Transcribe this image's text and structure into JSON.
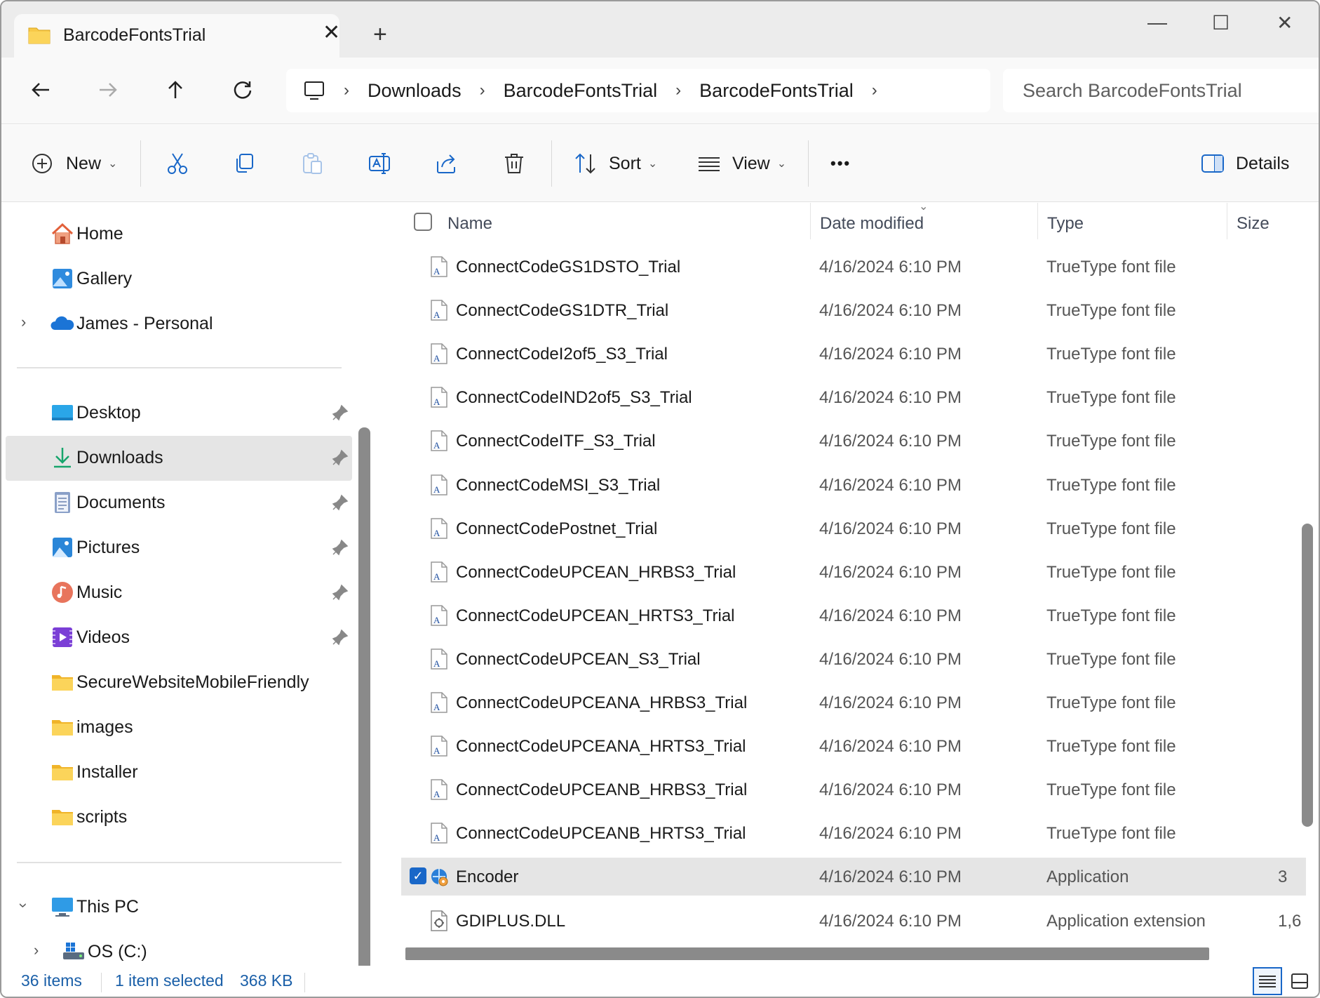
{
  "window": {
    "tab_title": "BarcodeFontsTrial",
    "tab_close": "✕",
    "new_tab": "+",
    "minimize": "—",
    "maximize": "☐",
    "close": "✕"
  },
  "breadcrumb": {
    "items": [
      "Downloads",
      "BarcodeFontsTrial",
      "BarcodeFontsTrial"
    ],
    "chevron": "›"
  },
  "search": {
    "placeholder": "Search BarcodeFontsTrial"
  },
  "toolbar": {
    "new_label": "New",
    "sort_label": "Sort",
    "view_label": "View",
    "more_label": "•••",
    "details_label": "Details",
    "caret": "⌄"
  },
  "sidebar": {
    "top": [
      {
        "label": "Home",
        "icon": "home-icon"
      },
      {
        "label": "Gallery",
        "icon": "gallery-icon"
      },
      {
        "label": "James - Personal",
        "icon": "onedrive-icon"
      }
    ],
    "quick": [
      {
        "label": "Desktop",
        "icon": "desktop-icon",
        "pinned": true
      },
      {
        "label": "Downloads",
        "icon": "downloads-icon",
        "pinned": true,
        "selected": true
      },
      {
        "label": "Documents",
        "icon": "documents-icon",
        "pinned": true
      },
      {
        "label": "Pictures",
        "icon": "pictures-icon",
        "pinned": true
      },
      {
        "label": "Music",
        "icon": "music-icon",
        "pinned": true
      },
      {
        "label": "Videos",
        "icon": "videos-icon",
        "pinned": true
      },
      {
        "label": "SecureWebsiteMobileFriendly",
        "icon": "folder-icon"
      },
      {
        "label": "images",
        "icon": "folder-icon"
      },
      {
        "label": "Installer",
        "icon": "folder-icon"
      },
      {
        "label": "scripts",
        "icon": "folder-icon"
      }
    ],
    "this_pc": "This PC",
    "os_drive": "OS (C:)"
  },
  "columns": {
    "name": "Name",
    "date": "Date modified",
    "type": "Type",
    "size": "Size"
  },
  "files": [
    {
      "name": "ConnectCodeGS1DSTO_Trial",
      "date": "4/16/2024 6:10 PM",
      "type": "TrueType font file",
      "size": ""
    },
    {
      "name": "ConnectCodeGS1DTR_Trial",
      "date": "4/16/2024 6:10 PM",
      "type": "TrueType font file",
      "size": ""
    },
    {
      "name": "ConnectCodeI2of5_S3_Trial",
      "date": "4/16/2024 6:10 PM",
      "type": "TrueType font file",
      "size": ""
    },
    {
      "name": "ConnectCodeIND2of5_S3_Trial",
      "date": "4/16/2024 6:10 PM",
      "type": "TrueType font file",
      "size": ""
    },
    {
      "name": "ConnectCodeITF_S3_Trial",
      "date": "4/16/2024 6:10 PM",
      "type": "TrueType font file",
      "size": ""
    },
    {
      "name": "ConnectCodeMSI_S3_Trial",
      "date": "4/16/2024 6:10 PM",
      "type": "TrueType font file",
      "size": ""
    },
    {
      "name": "ConnectCodePostnet_Trial",
      "date": "4/16/2024 6:10 PM",
      "type": "TrueType font file",
      "size": ""
    },
    {
      "name": "ConnectCodeUPCEAN_HRBS3_Trial",
      "date": "4/16/2024 6:10 PM",
      "type": "TrueType font file",
      "size": ""
    },
    {
      "name": "ConnectCodeUPCEAN_HRTS3_Trial",
      "date": "4/16/2024 6:10 PM",
      "type": "TrueType font file",
      "size": ""
    },
    {
      "name": "ConnectCodeUPCEAN_S3_Trial",
      "date": "4/16/2024 6:10 PM",
      "type": "TrueType font file",
      "size": ""
    },
    {
      "name": "ConnectCodeUPCEANA_HRBS3_Trial",
      "date": "4/16/2024 6:10 PM",
      "type": "TrueType font file",
      "size": ""
    },
    {
      "name": "ConnectCodeUPCEANA_HRTS3_Trial",
      "date": "4/16/2024 6:10 PM",
      "type": "TrueType font file",
      "size": ""
    },
    {
      "name": "ConnectCodeUPCEANB_HRBS3_Trial",
      "date": "4/16/2024 6:10 PM",
      "type": "TrueType font file",
      "size": ""
    },
    {
      "name": "ConnectCodeUPCEANB_HRTS3_Trial",
      "date": "4/16/2024 6:10 PM",
      "type": "TrueType font file",
      "size": ""
    },
    {
      "name": "Encoder",
      "date": "4/16/2024 6:10 PM",
      "type": "Application",
      "size": "3",
      "selected": true
    },
    {
      "name": "GDIPLUS.DLL",
      "date": "4/16/2024 6:10 PM",
      "type": "Application extension",
      "size": "1,6"
    }
  ],
  "status": {
    "items": "36 items",
    "selected": "1 item selected",
    "size": "368 KB"
  },
  "colors": {
    "accent": "#1967c8",
    "folder": "#f7c948",
    "selection": "#e5e5e5"
  }
}
